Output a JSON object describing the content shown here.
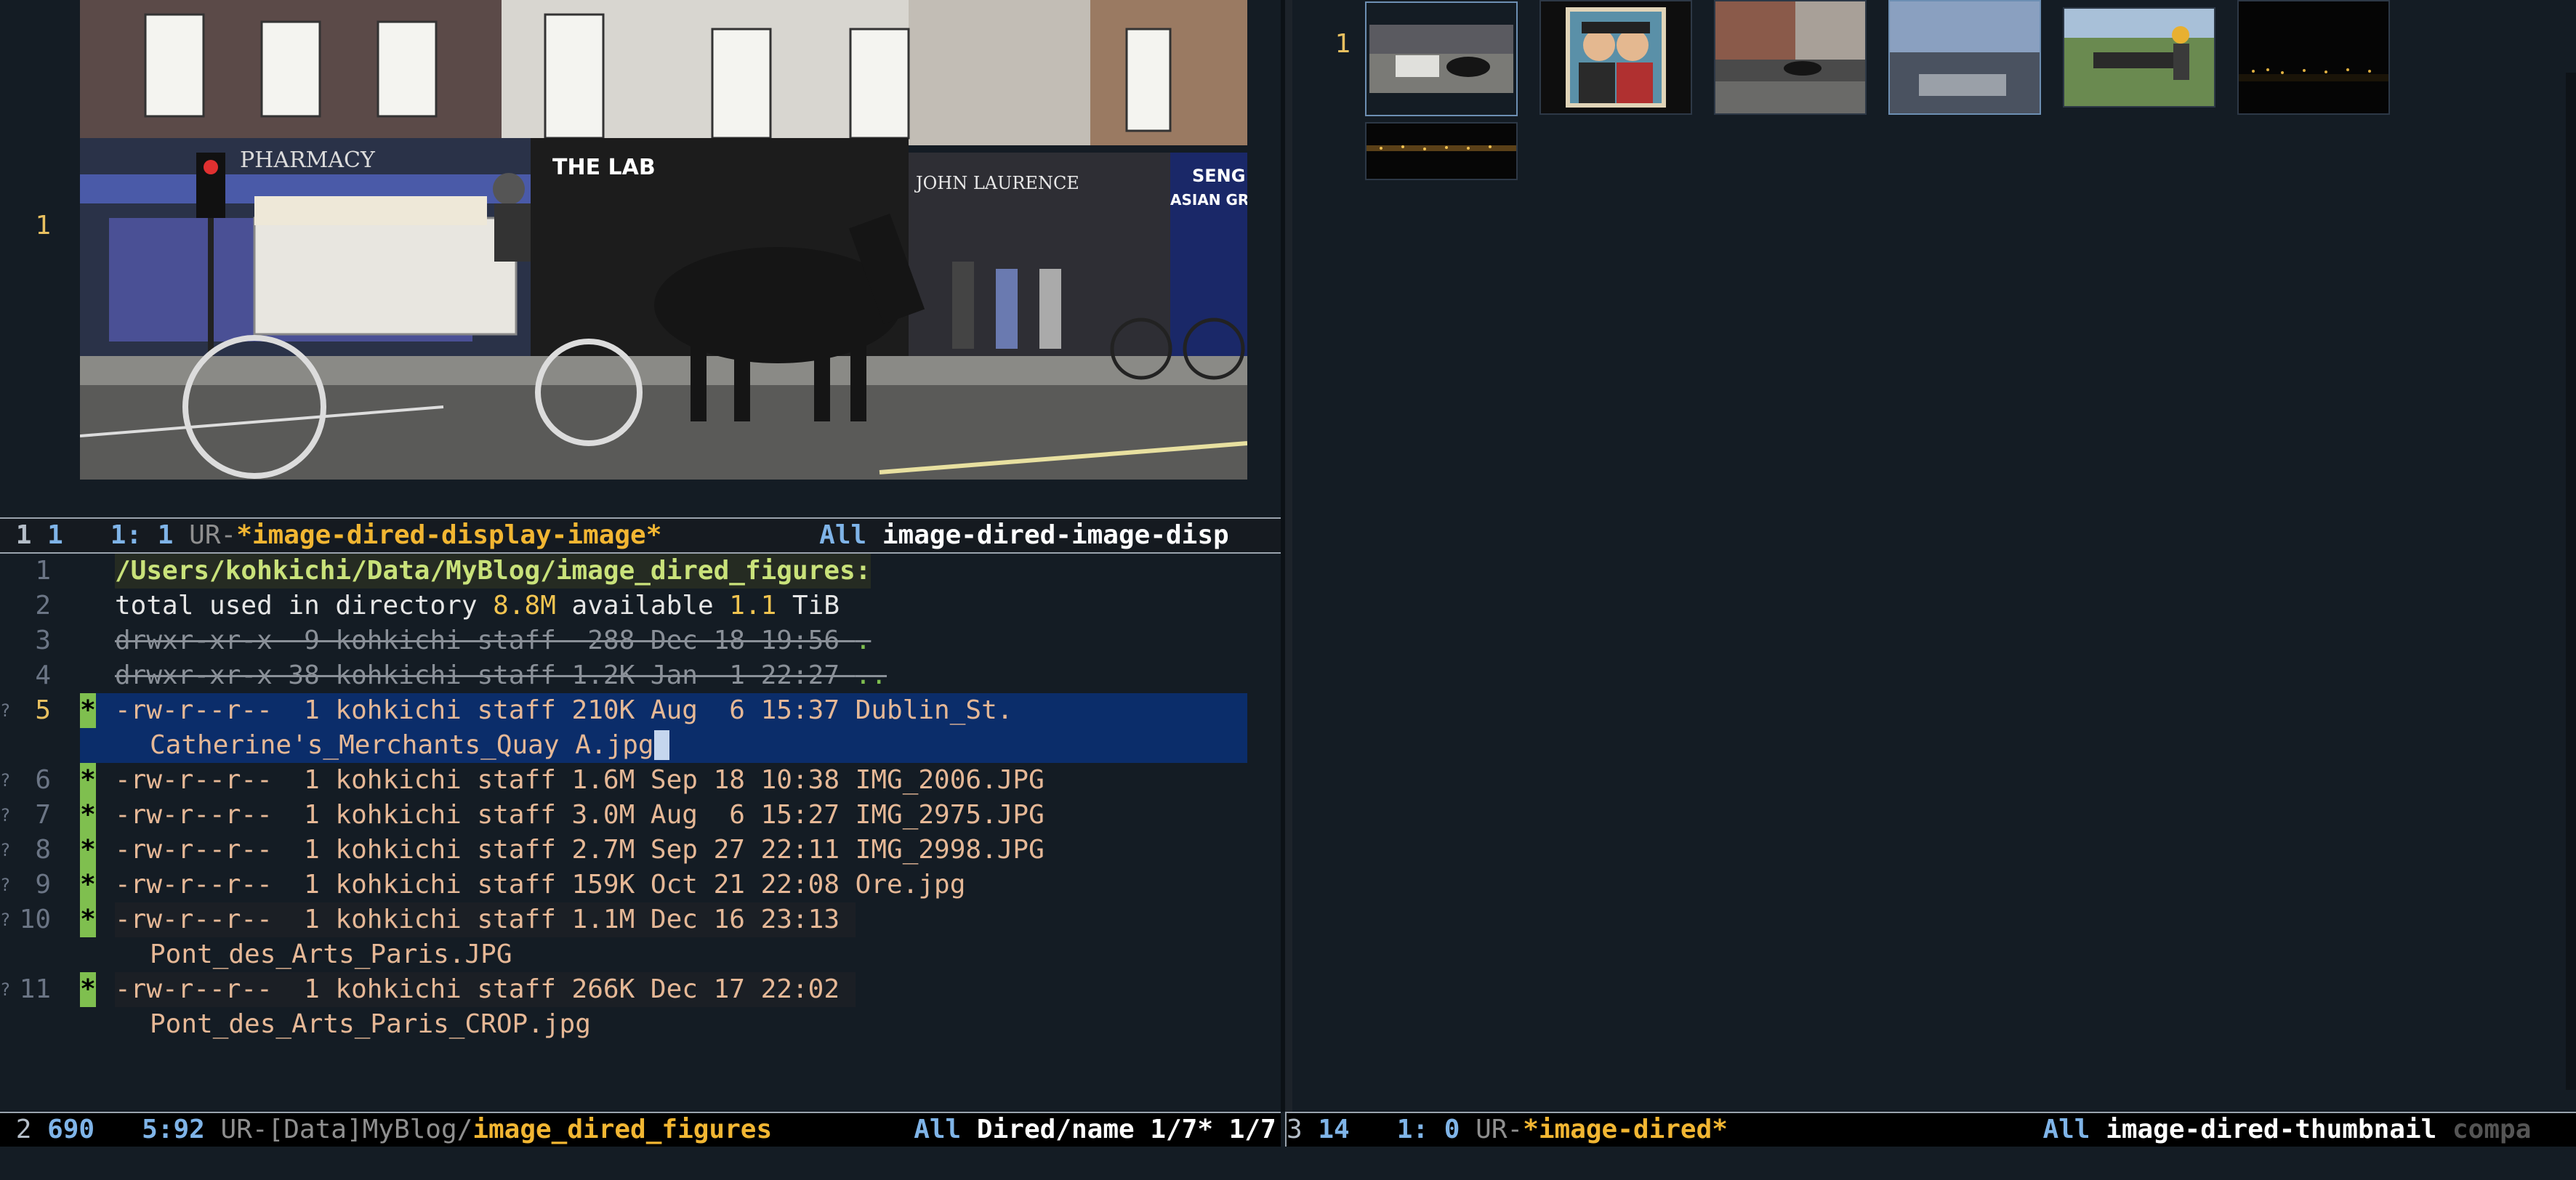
{
  "image_window": {
    "line_number": "1",
    "photo_labels": {
      "pharmacy": "PHARMACY",
      "the_lab": "THE LAB",
      "john_laurence": "JOHN LAURENCE",
      "asian_groc": "ASIAN GROC",
      "seng": "SENG"
    }
  },
  "top_modeline": {
    "window_num": "1",
    "pos_a": "1",
    "pos_b": "1: 1",
    "flags": "UR-",
    "buffer": "*image-dired-display-image*",
    "scope": "All",
    "mode": "image-dired-image-disp"
  },
  "dired": {
    "header_path": "/Users/kohkichi/Data/MyBlog/image_dired_figures:",
    "total_prefix": "total used in directory ",
    "total_used": "8.8M",
    "available_label": " available ",
    "available_value": "1.1",
    "available_unit": " TiB",
    "lines": [
      {
        "num": "1"
      },
      {
        "num": "2"
      },
      {
        "num": "3",
        "perm": "drwxr-xr-x  9 kohkichi staff  288 Dec 18 19:56 ",
        "name": "."
      },
      {
        "num": "4",
        "perm": "drwxr-xr-x 38 kohkichi staff 1.2K Jan  1 22:27 ",
        "name": ".."
      },
      {
        "num": "5",
        "mark": "*",
        "perm": "-rw-r--r--  1 kohkichi staff 210K Aug  6 15:37 ",
        "name": "Dublin_St.",
        "name_cont": "Catherine's_Merchants_Quay A.jpg"
      },
      {
        "num": "6",
        "mark": "*",
        "perm": "-rw-r--r--  1 kohkichi staff 1.6M Sep 18 10:38 ",
        "name": "IMG_2006.JPG"
      },
      {
        "num": "7",
        "mark": "*",
        "perm": "-rw-r--r--  1 kohkichi staff 3.0M Aug  6 15:27 ",
        "name": "IMG_2975.JPG"
      },
      {
        "num": "8",
        "mark": "*",
        "perm": "-rw-r--r--  1 kohkichi staff 2.7M Sep 27 22:11 ",
        "name": "IMG_2998.JPG"
      },
      {
        "num": "9",
        "mark": "*",
        "perm": "-rw-r--r--  1 kohkichi staff 159K Oct 21 22:08 ",
        "name": "Ore.jpg"
      },
      {
        "num": "10",
        "mark": "*",
        "perm": "-rw-r--r--  1 kohkichi staff 1.1M Dec 16 23:13 ",
        "name": "",
        "name_cont": "Pont_des_Arts_Paris.JPG"
      },
      {
        "num": "11",
        "mark": "*",
        "perm": "-rw-r--r--  1 kohkichi staff 266K Dec 17 22:02 ",
        "name": "",
        "name_cont": "Pont_des_Arts_Paris_CROP.jpg"
      }
    ]
  },
  "bottom_left_modeline": {
    "window_num": "2",
    "size": "690",
    "pos": "5:92",
    "flags": "UR-",
    "path_prefix": "[Data]MyBlog/",
    "buffer": "image_dired_figures",
    "scope": "All",
    "mode": "Dired/name 1/7* 1/7 "
  },
  "thumbnails": {
    "line_number": "1",
    "items": [
      {
        "name": "carriage-thumb"
      },
      {
        "name": "portrait-thumb"
      },
      {
        "name": "street-thumb"
      },
      {
        "name": "harbour-thumb"
      },
      {
        "name": "statue-thumb"
      },
      {
        "name": "night-thumb"
      },
      {
        "name": "night-bridge-thumb"
      }
    ]
  },
  "right_modeline": {
    "window_num": "3",
    "size": "14",
    "pos": "1: 0",
    "flags": "UR-",
    "buffer": "*image-dired*",
    "scope": "All",
    "mode": "image-dired-thumbnail",
    "extra": "compa"
  }
}
